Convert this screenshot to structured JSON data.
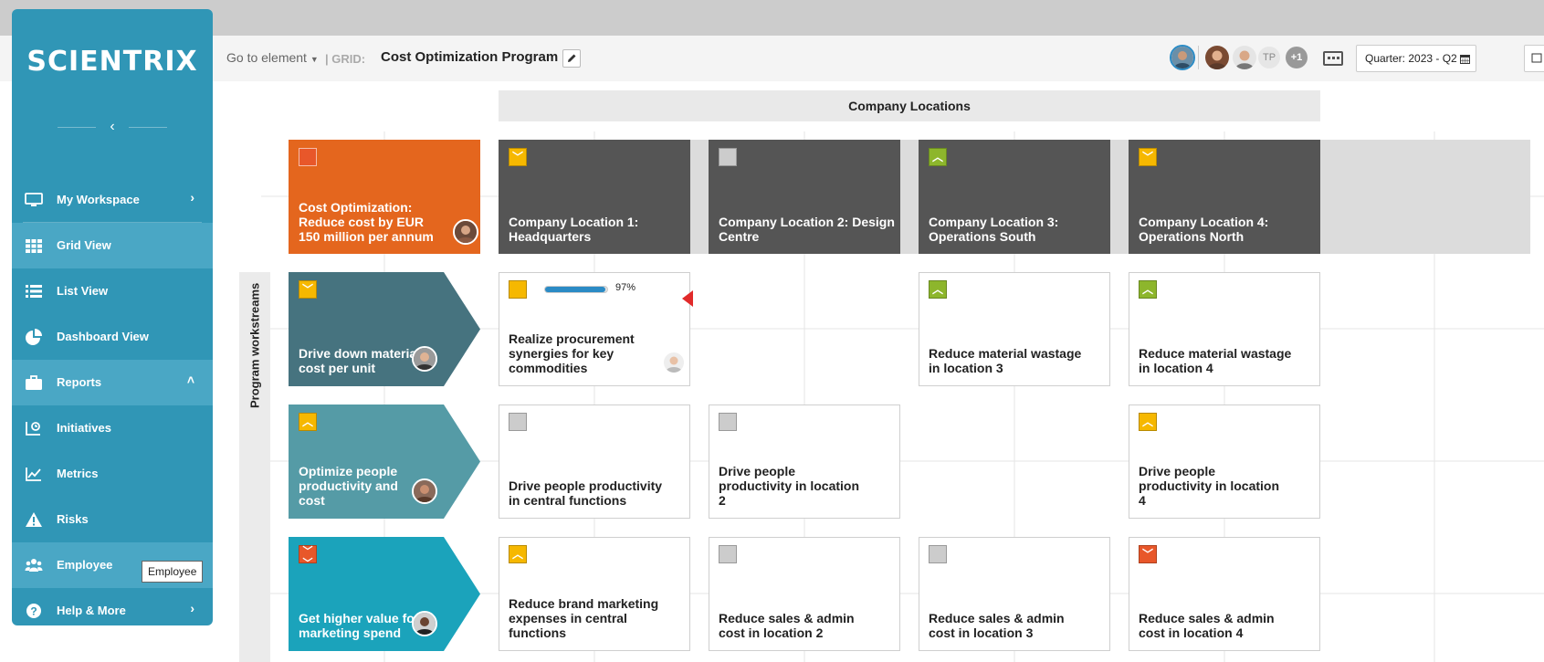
{
  "sidebar": {
    "logo": "SCIENTRIX",
    "items": [
      {
        "label": "My Workspace",
        "icon": "monitor-icon",
        "arrow": "›"
      },
      {
        "label": "Grid View",
        "icon": "grid-icon"
      },
      {
        "label": "List View",
        "icon": "list-icon"
      },
      {
        "label": "Dashboard View",
        "icon": "pie-chart-icon"
      },
      {
        "label": "Reports",
        "icon": "briefcase-icon",
        "arrow": "˄"
      },
      {
        "label": "Initiatives",
        "icon": "initiatives-icon"
      },
      {
        "label": "Metrics",
        "icon": "line-chart-icon"
      },
      {
        "label": "Risks",
        "icon": "warning-icon"
      },
      {
        "label": "Employee",
        "icon": "people-icon"
      },
      {
        "label": "Help & More",
        "icon": "help-icon",
        "arrow": "›"
      }
    ],
    "tooltip": "Employee"
  },
  "header": {
    "goto": "Go to element",
    "grid_label": "| GRID:",
    "grid_title": "Cost Optimization Program",
    "tp": "TP",
    "plus": "+1",
    "quarter": "Quarter: 2023 - Q2"
  },
  "grid": {
    "group_header": "Company Locations",
    "row_axis_label": "Program workstreams",
    "corner": {
      "title": "Cost Optimization: Reduce cost by EUR 150 million per annum",
      "color": "#e4661e"
    },
    "columns": [
      {
        "title": "Company Location 1: Headquarters",
        "status": "yellow-down"
      },
      {
        "title": "Company Location 2: Design Centre",
        "status": "grey"
      },
      {
        "title": "Company Location 3: Operations South",
        "status": "green-up"
      },
      {
        "title": "Company Location 4: Operations North",
        "status": "yellow-down"
      }
    ],
    "rows": [
      {
        "title": "Drive down material cost per unit",
        "status": "yellow-down",
        "color": "#46737f"
      },
      {
        "title": "Optimize people productivity and cost",
        "status": "yellow-up",
        "color": "#559ba6"
      },
      {
        "title": "Get higher value for marketing spend",
        "status": "orange-double-down",
        "color": "#1ba3bb"
      }
    ],
    "cards": {
      "r1c1": {
        "title": "Realize procurement synergies for key commodities",
        "progress": 97,
        "progress_label": "97%"
      },
      "r1c3": {
        "title": "Reduce material wastage in location 3"
      },
      "r1c4": {
        "title": "Reduce material wastage in location 4"
      },
      "r2c1": {
        "title": "Drive people productivity in central functions"
      },
      "r2c2": {
        "title": "Drive people productivity in location 2"
      },
      "r2c4": {
        "title": "Drive people productivity in location 4"
      },
      "r3c1": {
        "title": "Reduce brand marketing expenses in central functions"
      },
      "r3c2": {
        "title": "Reduce sales & admin cost in location 2"
      },
      "r3c3": {
        "title": "Reduce sales & admin cost in location 3"
      },
      "r3c4": {
        "title": "Reduce sales & admin cost in location 4"
      }
    }
  },
  "colors": {
    "sidebar": "#3096b6",
    "column_header": "#555555",
    "status_yellow": "#f6b800",
    "status_green": "#8db62c",
    "status_grey": "#cccccc",
    "status_orange": "#e8572a"
  }
}
